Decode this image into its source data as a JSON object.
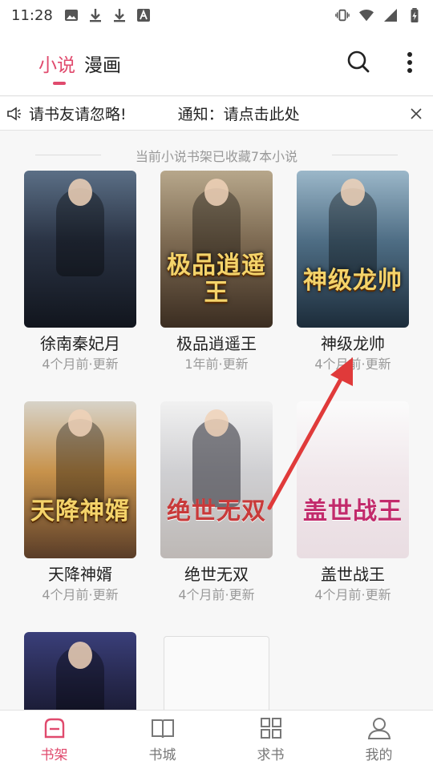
{
  "status_bar": {
    "time": "11:28",
    "left_icons": [
      "image-icon",
      "download-icon",
      "download-icon",
      "font-icon"
    ],
    "right_icons": [
      "vibrate-icon",
      "wifi-icon",
      "signal-icon",
      "battery-icon"
    ]
  },
  "header": {
    "tabs": [
      {
        "label": "小说",
        "active": true
      },
      {
        "label": "漫画",
        "active": false
      }
    ],
    "icons": [
      "search-icon",
      "more-icon"
    ],
    "accent_color": "#e04a6d"
  },
  "notice": {
    "segments": [
      "请书友请忽略!",
      "通知：请点击此处"
    ],
    "icon": "speaker-icon",
    "close_icon": "close-icon"
  },
  "shelf": {
    "summary": "当前小说书架已收藏7本小说",
    "books": [
      {
        "title": "徐南秦妃月",
        "updated": "4个月前·更新"
      },
      {
        "title": "极品逍遥王",
        "updated": "1年前·更新",
        "cover_text": "极品逍遥王"
      },
      {
        "title": "神级龙帅",
        "updated": "4个月前·更新",
        "cover_text": "神级龙帅"
      },
      {
        "title": "天降神婿",
        "updated": "4个月前·更新",
        "cover_text": "天降神婿"
      },
      {
        "title": "绝世无双",
        "updated": "4个月前·更新",
        "cover_text": "绝世无双"
      },
      {
        "title": "盖世战王",
        "updated": "4个月前·更新",
        "cover_text": "盖世战王"
      },
      {
        "title": "",
        "updated": ""
      }
    ],
    "add_icon": "plus-icon"
  },
  "bottom_nav": {
    "items": [
      {
        "label": "书架",
        "icon": "bookshelf-icon",
        "active": true
      },
      {
        "label": "书城",
        "icon": "book-icon",
        "active": false
      },
      {
        "label": "求书",
        "icon": "grid-icon",
        "active": false
      },
      {
        "label": "我的",
        "icon": "user-icon",
        "active": false
      }
    ]
  }
}
